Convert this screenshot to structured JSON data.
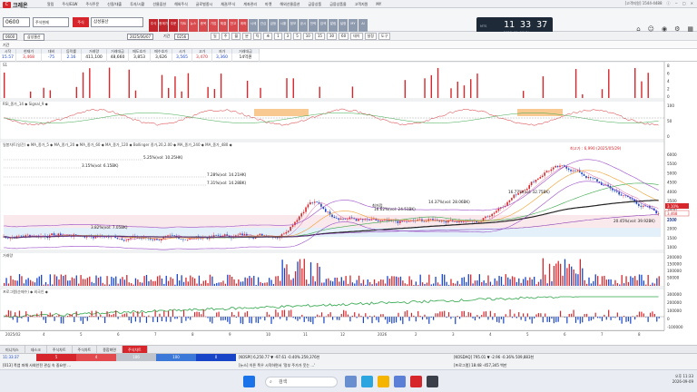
{
  "app": {
    "logo_mark": "C",
    "name": "크레온"
  },
  "menu": [
    "알림",
    "주식/ELW",
    "주식주문",
    "신용/대출",
    "투자/시황",
    "선물옵션",
    "해외주식",
    "글로벌종시",
    "채권/주식",
    "계좌관리",
    "마켓",
    "해외선물옵션",
    "금융상품",
    "금융상품몰",
    "고객지원",
    "MY"
  ],
  "top_right": [
    "[고객지원] 1544-4488",
    "ⓘ",
    "−",
    "□",
    "×"
  ],
  "symbol": {
    "code": "0600",
    "type_btn": "주식현재",
    "name": "삼성물산",
    "date": "2025/06/07",
    "period_label": "기간",
    "period": "0256"
  },
  "tiles": [
    "주식",
    "현재가",
    "주문",
    "차트",
    "뉴스",
    "종목",
    "기업",
    "체결",
    "잔고",
    "계좌",
    "시세",
    "관심",
    "급등",
    "시황",
    "정보",
    "공시",
    "전략",
    "검색",
    "알림",
    "설정",
    "MY",
    "AI"
  ],
  "clock": {
    "label": "MTS",
    "time": "11 33 37",
    "date": "2026. 09. 06(수)"
  },
  "chart_toolbar": [
    "일",
    "주",
    "월",
    "분",
    "틱",
    "초",
    "1",
    "3",
    "5",
    "10",
    "15",
    "30",
    "60",
    "데이",
    "설정",
    "도구"
  ],
  "quote": {
    "headers": [
      "시작",
      "현재가",
      "대비",
      "등락률",
      "거래량",
      "거래대금",
      "매도호가",
      "매수호가",
      "시가",
      "고가",
      "저가",
      "거래대금"
    ],
    "values": [
      "15.57",
      "3,468",
      "-75",
      "2.16",
      "411,100",
      "48,660",
      "3,853",
      "3,626",
      "3,565",
      "3,470",
      "3,360",
      "14억원"
    ],
    "colors": [
      "#1844c7",
      "#d7262b",
      "#1844c7",
      "#1844c7",
      "#222",
      "#222",
      "#222",
      "#222",
      "#1844c7",
      "#d7262b",
      "#1844c7",
      "#222"
    ]
  },
  "panes": {
    "p1_label": "S1",
    "rsi_label": "RSI_종가_14 ◆ Signal_9 ◆",
    "main_label": "일봉차트(일간) ◆ MA_종가_5 ◆ MA_종가_20 ◆ MA_종가_60 ◆ MA_종가_120 ◆ Bollinger 종가,20,2.00 ◆ MA_종가_240 ◆ MA_종가_480 ◆",
    "vol_label": "거래량",
    "inst_label": "프로그램(순매수) ◆ 외국인 ◆"
  },
  "annotations": [
    "5.25%(vol: 10.25HK)",
    "3.15%(vol: 6.15BK)",
    "7.28%(vol: 14.21HK)",
    "7.31%(vol: 14.28BK)",
    "16.77%(vol: 32.75BK)",
    "14.37%(vol: 28.06BK)",
    "16.62%(vol: 24.51BK)",
    "3.82%(vol: 7.05BK)",
    "최고가 : 6,990 (2025/05/29)",
    "20.45%(vol: 39.92BK)",
    "최저점"
  ],
  "axis_right_main": [
    "6000",
    "5500",
    "5000",
    "4500",
    "4000",
    "3500",
    "3000",
    "2500",
    "2000",
    "1500",
    "1000"
  ],
  "axis_right_vol": [
    "200000",
    "150000",
    "100000",
    "50000",
    "0"
  ],
  "axis_right_inst": [
    "300000",
    "200000",
    "100000",
    "0",
    "-100000"
  ],
  "axis_right_p1": [
    "8",
    "6",
    "4",
    "2",
    "0"
  ],
  "axis_right_rsi": [
    "100",
    "50",
    "0"
  ],
  "markers": {
    "high": "3.10%",
    "mid": "3,468",
    "low": "2000"
  },
  "time_labels": [
    "2025/02",
    "4",
    "5",
    "6",
    "7",
    "8",
    "9",
    "10",
    "11",
    "12",
    "2026",
    "2",
    "3",
    "4",
    "5",
    "6",
    "7",
    "8"
  ],
  "bottom_tabs": [
    "미니차스",
    "데스크",
    "주식차트",
    "주식차트",
    "종합화면",
    "주식차트"
  ],
  "status": {
    "time": "11:33:37",
    "ticks": [
      "5",
      "4",
      "186",
      "100",
      "0"
    ],
    "kospi": "[KOSPI]  6,250.77  ▼ -97.61  -0.40%  259,376천",
    "kosdaq": "[KOSDAQ]  795.01  ▼ -2.96  -0.36%  509,883천",
    "news": "[013] 폭염 피해 사회안전 관심 속 중요한 ...",
    "news2": "[뉴스] 이른 폭우 시작하면서 '정부 주가가 웃는 ...'",
    "program": "[프로그램]  18:48  -457,345  백만"
  },
  "taskbar": {
    "search": "검색",
    "time": "오후 11:33",
    "date": "2026-09-09"
  }
}
